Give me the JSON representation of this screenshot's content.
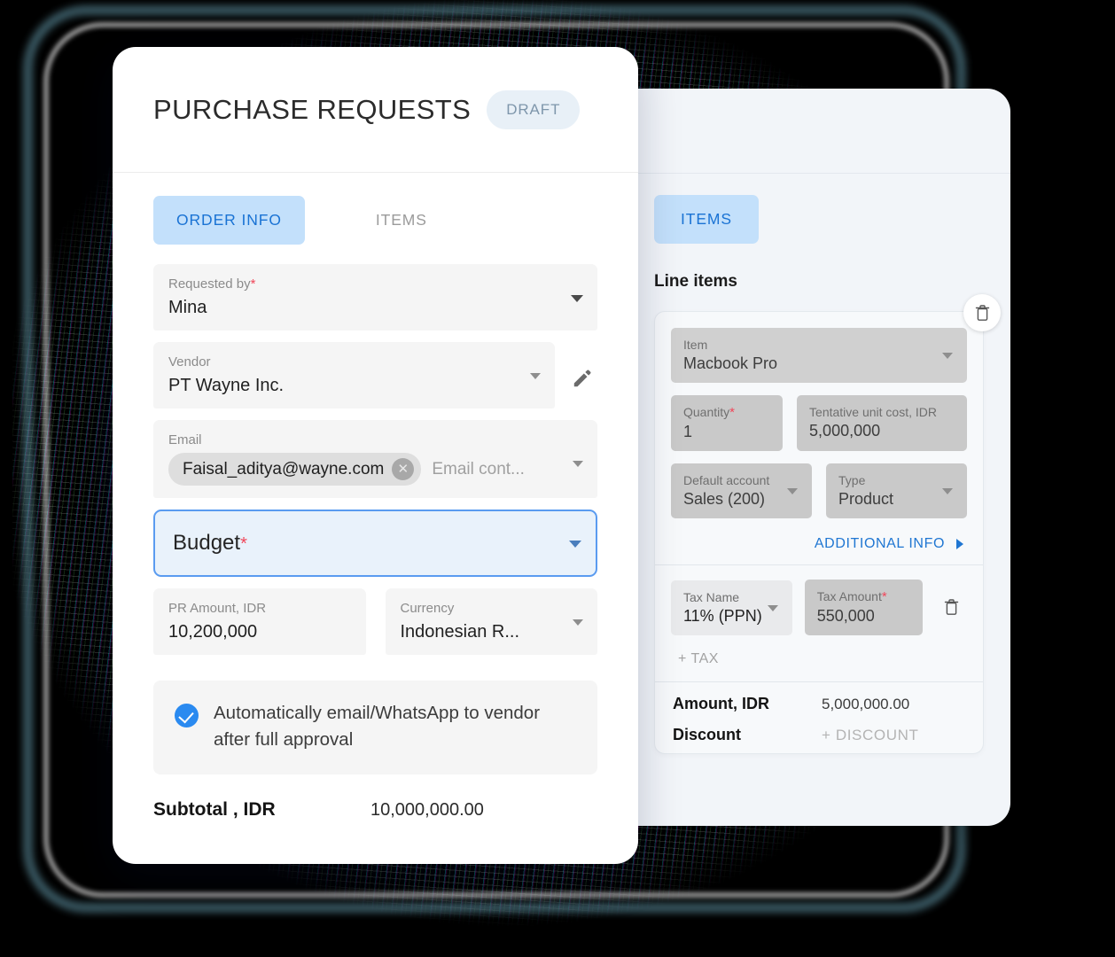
{
  "header": {
    "title": "PURCHASE REQUESTS",
    "status_badge": "DRAFT"
  },
  "tabs": [
    {
      "label": "ORDER INFO",
      "active": true
    },
    {
      "label": "ITEMS",
      "active": false
    }
  ],
  "order_info": {
    "requested_by": {
      "label": "Requested by",
      "required": true,
      "value": "Mina"
    },
    "vendor": {
      "label": "Vendor",
      "required": false,
      "value": "PT Wayne Inc.",
      "edit_icon": "pencil-icon"
    },
    "email": {
      "label": "Email",
      "chip_value": "Faisal_aditya@wayne.com",
      "chip_remove_icon": "close-circle-icon",
      "placeholder": "Email cont..."
    },
    "budget": {
      "label": "Budget",
      "required": true,
      "value": ""
    },
    "pr_amount": {
      "label": "PR Amount, IDR",
      "value": "10,200,000"
    },
    "currency": {
      "label": "Currency",
      "value": "Indonesian R..."
    },
    "auto_notify": {
      "checked": true,
      "label": "Automatically email/WhatsApp to vendor after full approval"
    },
    "subtotal": {
      "label": "Subtotal , IDR",
      "value": "10,000,000.00"
    }
  },
  "items_panel": {
    "tab_label": "ITEMS",
    "section_title": "Line items",
    "delete_item_icon": "trash-icon",
    "item": {
      "label": "Item",
      "value": "Macbook Pro"
    },
    "quantity": {
      "label": "Quantity",
      "required": true,
      "value": "1"
    },
    "unit_cost": {
      "label": "Tentative unit cost, IDR",
      "value": "5,000,000"
    },
    "default_account": {
      "label": "Default account",
      "value": "Sales (200)"
    },
    "type": {
      "label": "Type",
      "value": "Product"
    },
    "additional_info": {
      "label": "ADDITIONAL INFO",
      "icon": "chevron-right-icon"
    },
    "tax_name": {
      "label": "Tax Name",
      "value": "11% (PPN)"
    },
    "tax_amount": {
      "label": "Tax Amount",
      "required": true,
      "value": "550,000"
    },
    "delete_tax_icon": "trash-icon",
    "add_tax_label": "+ TAX",
    "amount": {
      "label": "Amount, IDR",
      "value": "5,000,000.00"
    },
    "discount": {
      "label": "Discount",
      "value": "+ DISCOUNT"
    }
  },
  "colors": {
    "accent_blue": "#1a73d4",
    "tab_active_bg": "#c3e0fb",
    "required_red": "#f0475a",
    "focus_border": "#5a9bf0",
    "checkbox_blue": "#2a8af0",
    "draft_badge_bg": "#e8f0f7",
    "draft_badge_text": "#7e96ab"
  }
}
